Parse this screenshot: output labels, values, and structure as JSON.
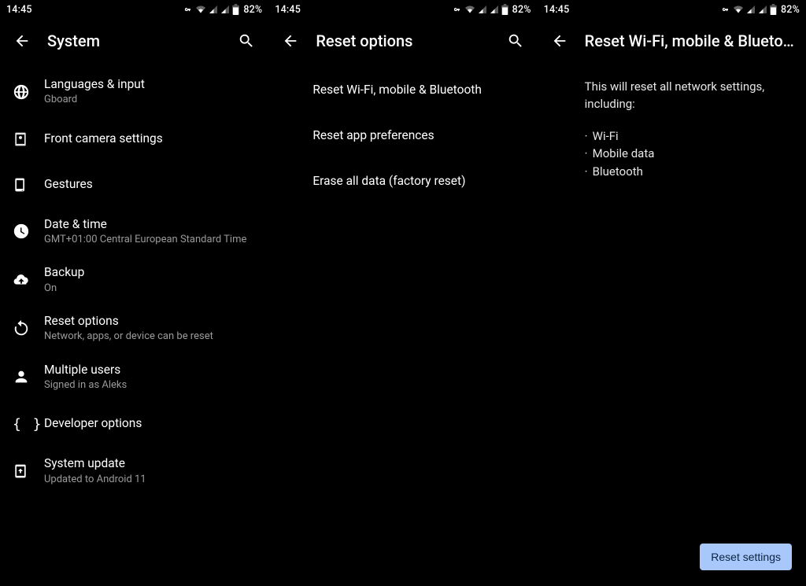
{
  "status": {
    "time": "14:45",
    "battery": "82%"
  },
  "screen1": {
    "title": "System",
    "items": [
      {
        "title": "Languages & input",
        "sub": "Gboard"
      },
      {
        "title": "Front camera settings",
        "sub": ""
      },
      {
        "title": "Gestures",
        "sub": ""
      },
      {
        "title": "Date & time",
        "sub": "GMT+01:00 Central European Standard Time"
      },
      {
        "title": "Backup",
        "sub": "On"
      },
      {
        "title": "Reset options",
        "sub": "Network, apps, or device can be reset"
      },
      {
        "title": "Multiple users",
        "sub": "Signed in as Aleks"
      },
      {
        "title": "Developer options",
        "sub": ""
      },
      {
        "title": "System update",
        "sub": "Updated to Android 11"
      }
    ]
  },
  "screen2": {
    "title": "Reset options",
    "items": [
      {
        "title": "Reset Wi-Fi, mobile & Bluetooth"
      },
      {
        "title": "Reset app preferences"
      },
      {
        "title": "Erase all data (factory reset)"
      }
    ]
  },
  "screen3": {
    "title": "Reset Wi-Fi, mobile & Blueto…",
    "intro": "This will reset all network settings, including:",
    "bullets": [
      "Wi-Fi",
      "Mobile data",
      "Bluetooth"
    ],
    "button": "Reset settings"
  }
}
